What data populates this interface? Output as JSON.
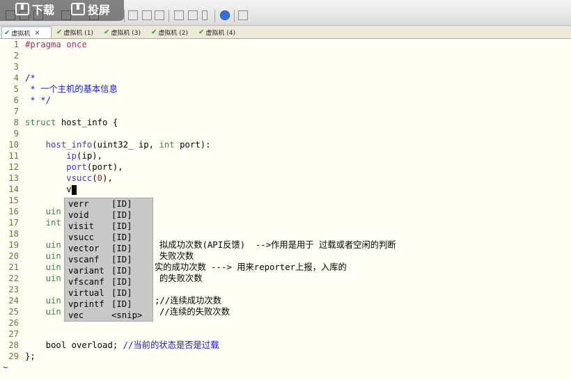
{
  "overlay": {
    "download_label": "下载",
    "cast_label": "投屏"
  },
  "tabs": [
    {
      "label": "虚拟机",
      "active": true,
      "close": "×"
    },
    {
      "label": "虚拟机 (1)"
    },
    {
      "label": "虚拟机 (3)"
    },
    {
      "label": "虚拟机 (2)"
    },
    {
      "label": "虚拟机 (4)"
    }
  ],
  "editor": {
    "line_numbers": [
      "1",
      "2",
      "3",
      "4",
      "5",
      "6",
      "7",
      "8",
      "9",
      "10",
      "11",
      "12",
      "13",
      "14",
      "15",
      "16",
      "17",
      "18",
      "19",
      "20",
      "21",
      "22",
      "23",
      "24",
      "25",
      "26",
      "27",
      "28",
      "29"
    ],
    "code": {
      "l1a": "#pragma",
      "l1b": " once",
      "l4": "/*",
      "l5": " * 一个主机的基本信息",
      "l6": " * */",
      "l8a": "struct",
      "l8b": " host_info {",
      "l10a": "    host_info",
      "l10b": "(uint32_ ip, ",
      "l10c": "int",
      "l10d": " port):",
      "l11a": "        ip",
      "l11b": "(ip),",
      "l12a": "        port",
      "l12b": "(port),",
      "l13a": "        vsucc",
      "l13b": "(",
      "l13c": "0",
      "l13d": "),",
      "l14": "        v",
      "l16": "    uin",
      "l17": "    int",
      "l19a": "    uin",
      "l19b": "拟成功次数(API反馈)  -->作用是用于 过载或者空闲的判断",
      "l20a": "    uin",
      "l20b": "失败次数",
      "l21a": "    uin",
      "l21b": "实的成功次数 ---> 用来reporter上报，入库的",
      "l22a": "    uin",
      "l22b": "的失败次数",
      "l24a": "    uin",
      "l24b": ";//连续成功次数",
      "l25a": "    uin",
      "l25b": "//连续的失败次数",
      "l28a": "    bool overload; ",
      "l28b": "//当前的状态是否是过载",
      "l29": "};"
    },
    "tilde": "~"
  },
  "completion": [
    {
      "name": "verr",
      "type": "[ID]"
    },
    {
      "name": "void",
      "type": "[ID]"
    },
    {
      "name": "visit",
      "type": "[ID]"
    },
    {
      "name": "vsucc",
      "type": "[ID]"
    },
    {
      "name": "vector",
      "type": "[ID]"
    },
    {
      "name": "vscanf",
      "type": "[ID]"
    },
    {
      "name": "variant",
      "type": "[ID]"
    },
    {
      "name": "vfscanf",
      "type": "[ID]"
    },
    {
      "name": "virtual",
      "type": "[ID]"
    },
    {
      "name": "vprintf",
      "type": "[ID]"
    },
    {
      "name": "vec",
      "type": "<snip>"
    }
  ]
}
